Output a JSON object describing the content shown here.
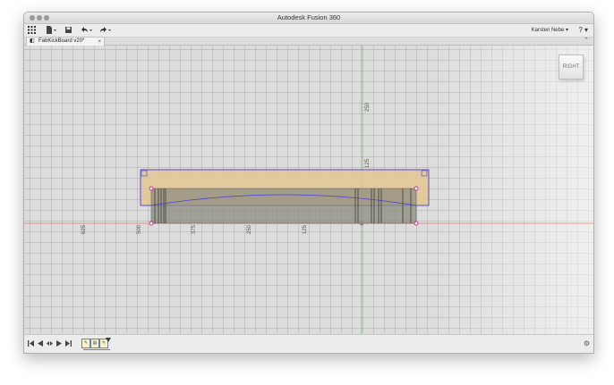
{
  "window": {
    "title": "Autodesk Fusion 360"
  },
  "toolbar": {
    "grid_icon": "grid-icon",
    "file_icon": "file-icon",
    "save_icon": "save-icon",
    "undo_icon": "undo-icon",
    "redo_icon": "redo-icon",
    "user_label": "Karsten Nebe ▾",
    "help_label": "? ▾"
  },
  "tabs": [
    {
      "label": "FabKickBoard v20*",
      "close": "×"
    }
  ],
  "tabbar": {
    "collapse": "⌃"
  },
  "viewcube": {
    "face": "RIGHT"
  },
  "axis_labels": {
    "horizontal": [
      "625",
      "500",
      "375",
      "250",
      "125"
    ],
    "vertical": [
      "250",
      "125"
    ]
  },
  "colors": {
    "board_fill": "#e3c793",
    "profile_fill": "#8c8c80",
    "sketch_line": "#4b3fcf",
    "x_axis": "#e0826a",
    "y_axis": "#6dbb6d",
    "point": "#c41f8f"
  },
  "timeline": {
    "first_icon": "skip-to-start-icon",
    "prev_icon": "step-back-icon",
    "play_icon": "play-icon",
    "next_icon": "step-forward-icon",
    "last_icon": "skip-to-end-icon",
    "settings_icon": "gear-icon",
    "features": [
      "sketch-feature-icon",
      "extrude-feature-icon",
      "sketch-feature-icon"
    ]
  }
}
